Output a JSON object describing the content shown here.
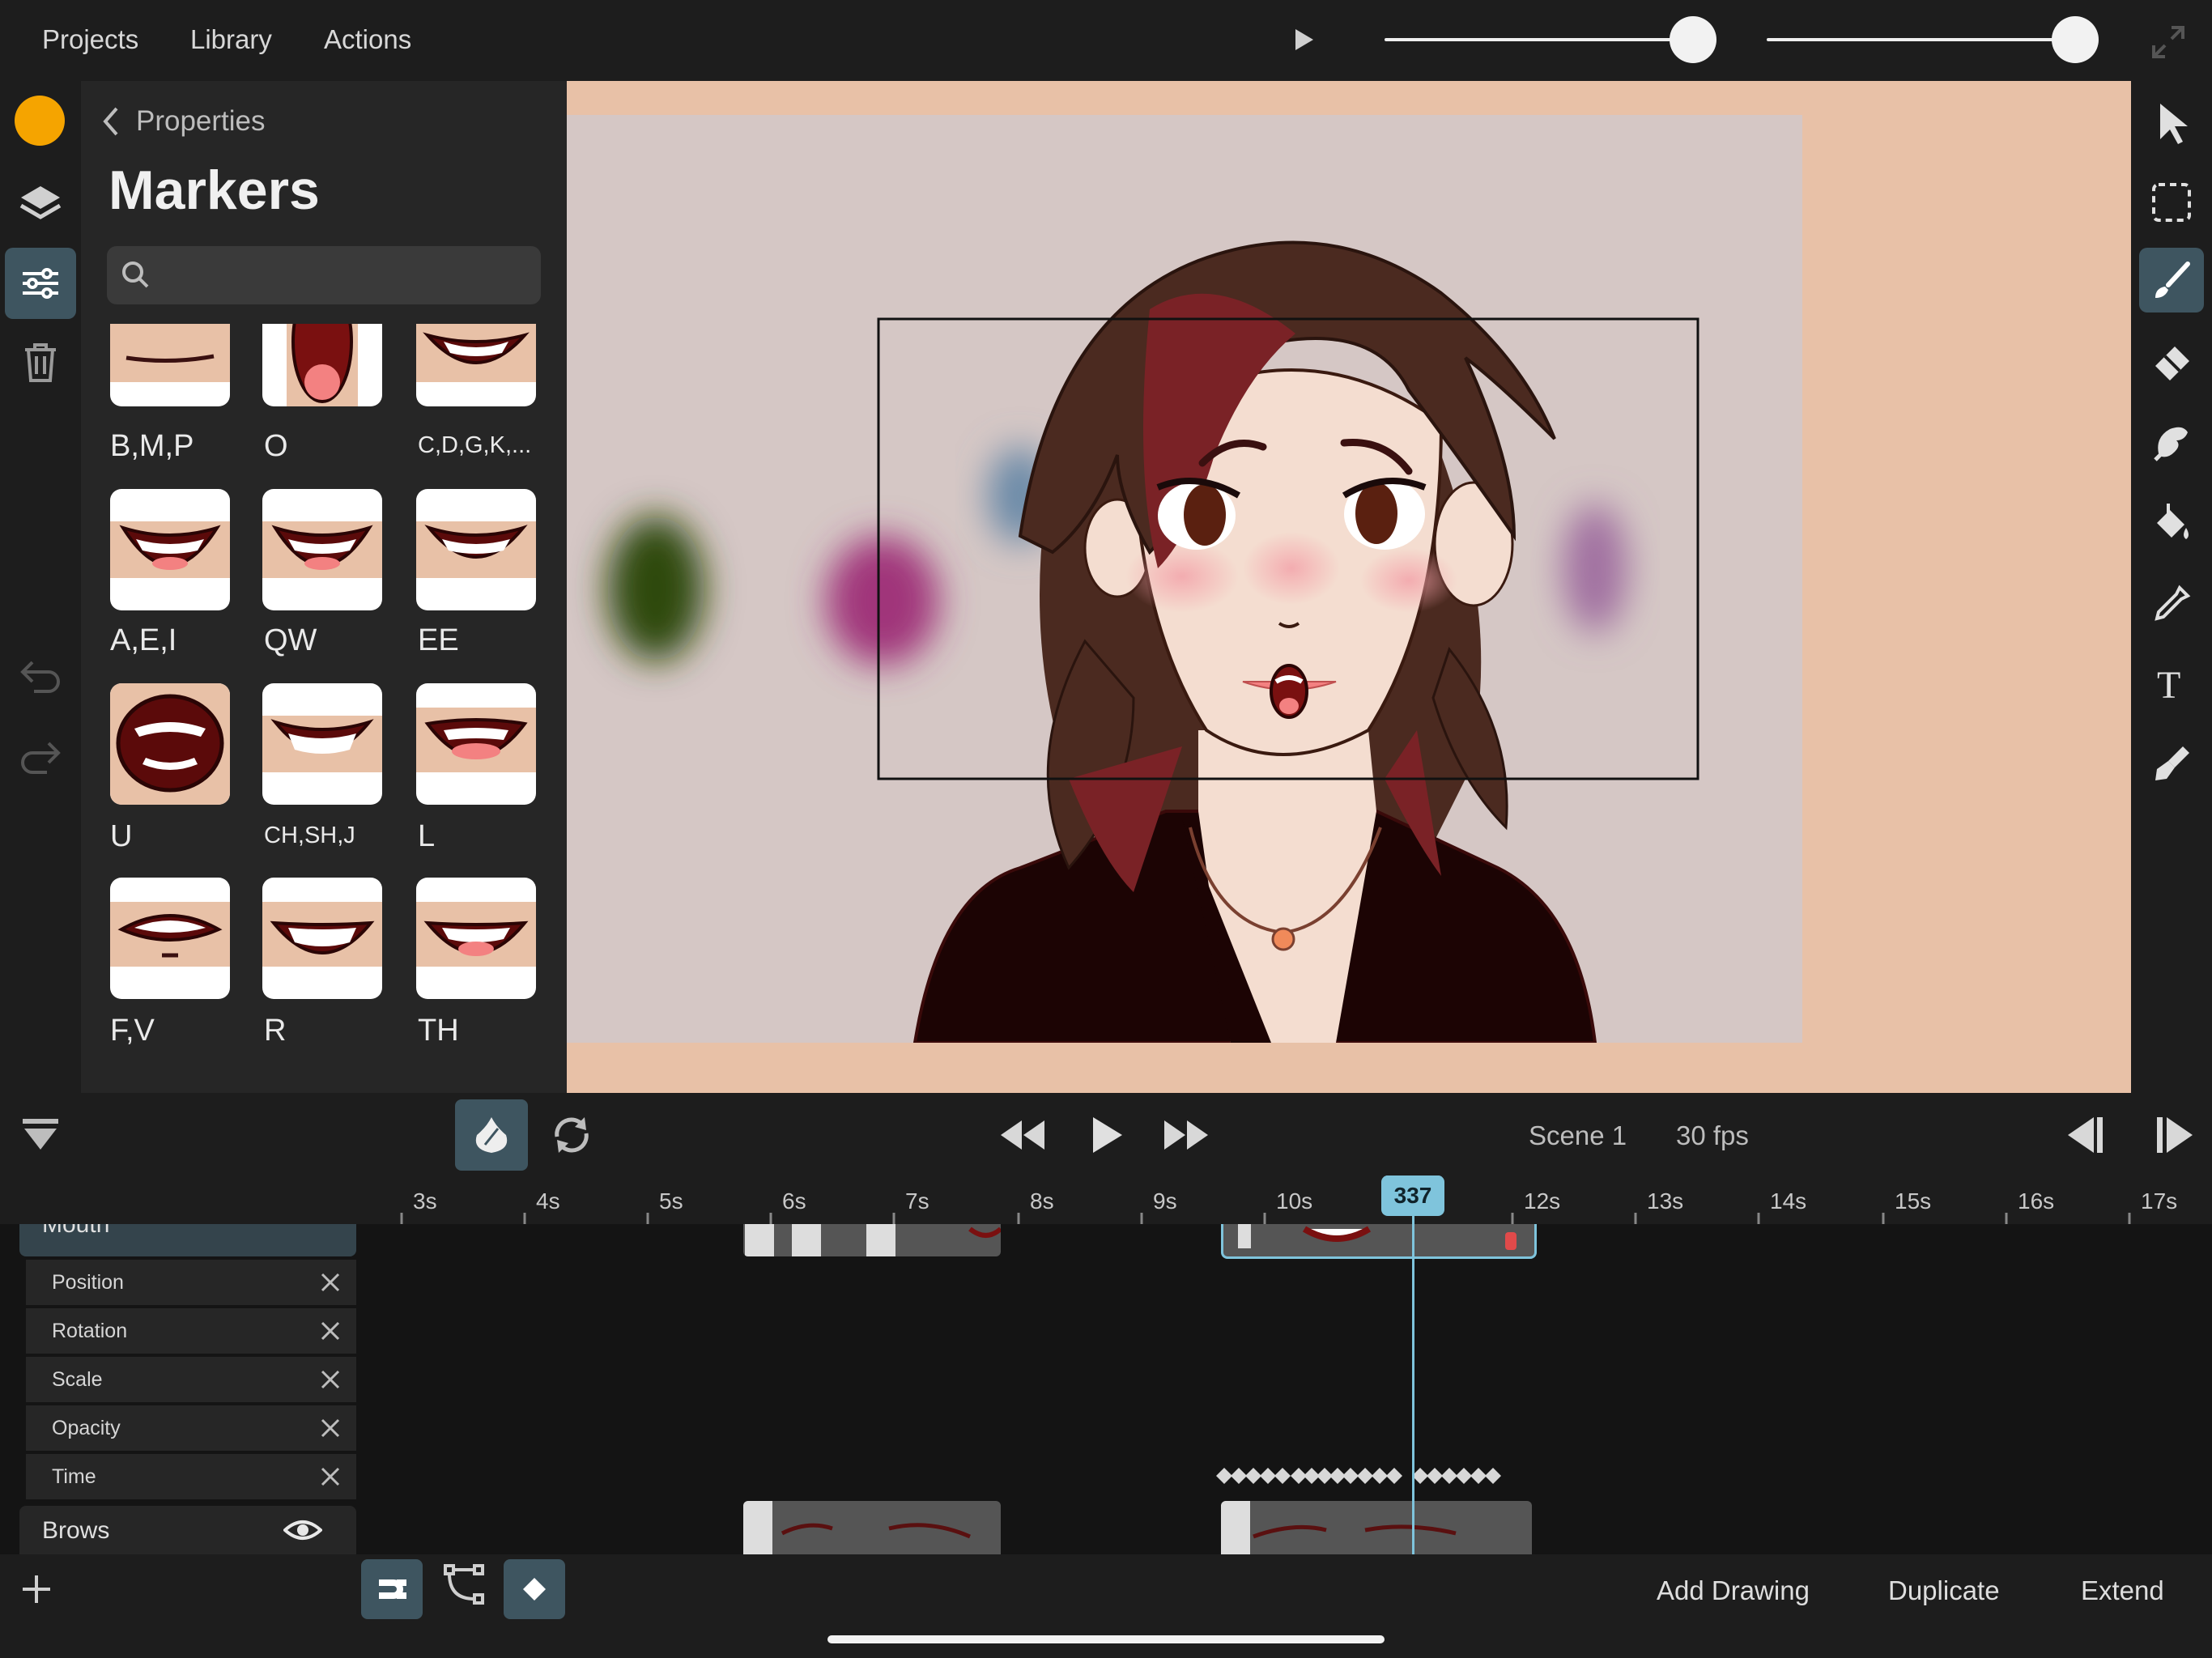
{
  "menu": {
    "projects": "Projects",
    "library": "Library",
    "actions": "Actions"
  },
  "sliders": {
    "first_level": 0.95,
    "second_level": 0.95
  },
  "panel": {
    "back_label": "Properties",
    "title": "Markers",
    "search_placeholder": "",
    "markers": [
      {
        "label": "B,M,P"
      },
      {
        "label": "O"
      },
      {
        "label": "C,D,G,K,..."
      },
      {
        "label": "A,E,I"
      },
      {
        "label": "QW"
      },
      {
        "label": "EE"
      },
      {
        "label": "U"
      },
      {
        "label": "CH,SH,J"
      },
      {
        "label": "L"
      },
      {
        "label": "F,V"
      },
      {
        "label": "R"
      },
      {
        "label": "TH"
      }
    ]
  },
  "colors": {
    "current": "#f5a400",
    "accent": "#7fc4dc",
    "canvas_bg": "#e8c1a7",
    "stage_bg": "#d5c7c5"
  },
  "playback": {
    "scene": "Scene 1",
    "fps": "30 fps"
  },
  "ruler": {
    "ticks": [
      "3s",
      "4s",
      "5s",
      "6s",
      "7s",
      "8s",
      "9s",
      "10s",
      "12s",
      "13s",
      "14s",
      "15s",
      "16s",
      "17s"
    ],
    "frame": "337"
  },
  "layers": {
    "mouth": "Mouth",
    "properties": [
      "Position",
      "Rotation",
      "Scale",
      "Opacity",
      "Time"
    ],
    "brows": "Brows"
  },
  "bottom": {
    "add_drawing": "Add Drawing",
    "duplicate": "Duplicate",
    "extend": "Extend"
  },
  "icons": {
    "top": [
      "play-icon",
      "fullscreen-icon"
    ],
    "left": [
      "color-swatch",
      "layers-icon",
      "properties-icon",
      "trash-icon",
      "undo-icon",
      "redo-icon"
    ],
    "right": [
      "select-arrow-icon",
      "selection-rect-icon",
      "brush-icon",
      "eraser-icon",
      "smudge-icon",
      "fill-icon",
      "eyedropper-icon",
      "text-icon",
      "pen-icon"
    ]
  }
}
